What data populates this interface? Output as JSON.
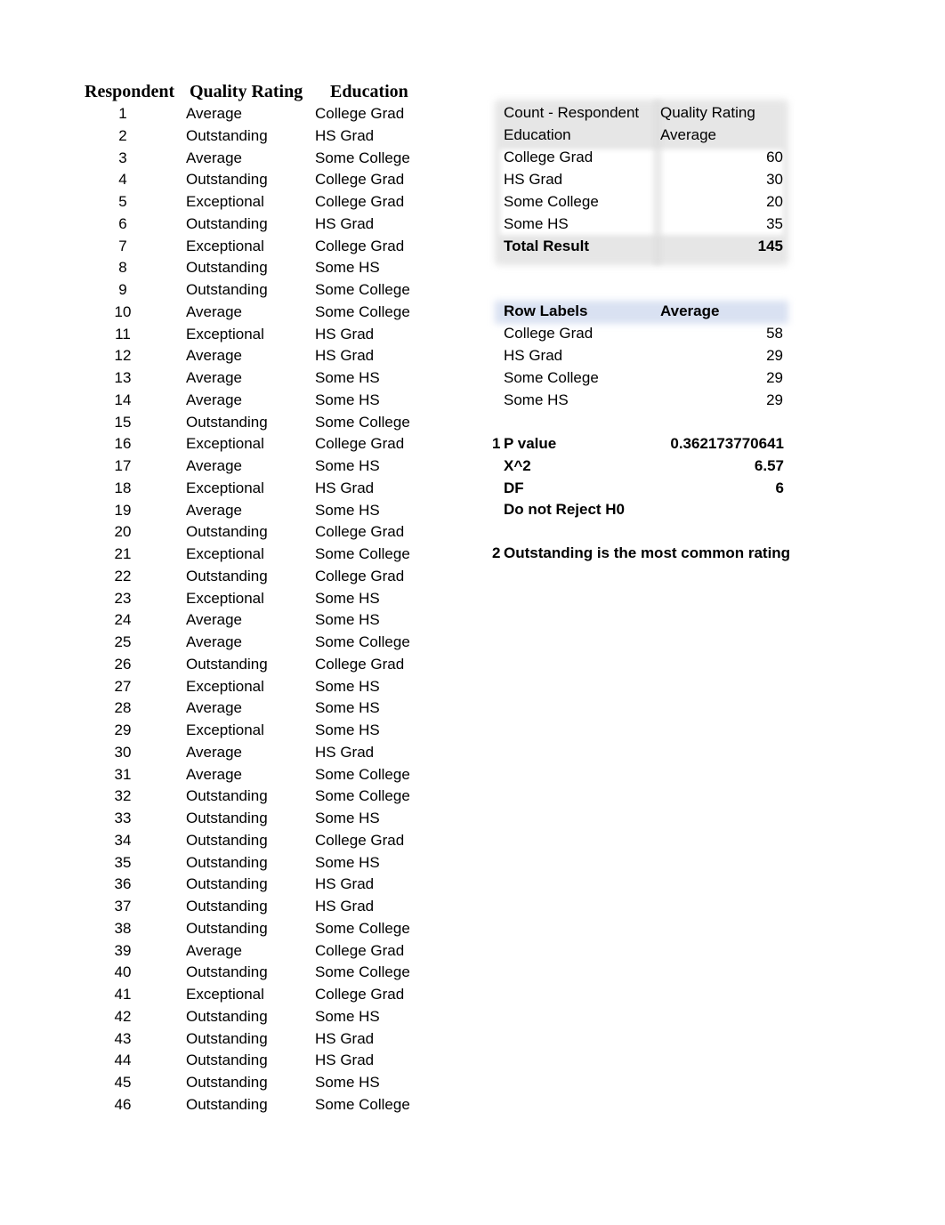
{
  "headers": {
    "respondent": "Respondent",
    "quality_rating": "Quality Rating",
    "education": "Education"
  },
  "rows": [
    {
      "n": "1",
      "q": "Average",
      "e": "College Grad"
    },
    {
      "n": "2",
      "q": "Outstanding",
      "e": "HS Grad"
    },
    {
      "n": "3",
      "q": "Average",
      "e": "Some College"
    },
    {
      "n": "4",
      "q": "Outstanding",
      "e": "College Grad"
    },
    {
      "n": "5",
      "q": "Exceptional",
      "e": "College Grad"
    },
    {
      "n": "6",
      "q": "Outstanding",
      "e": "HS Grad"
    },
    {
      "n": "7",
      "q": "Exceptional",
      "e": "College Grad"
    },
    {
      "n": "8",
      "q": "Outstanding",
      "e": "Some HS"
    },
    {
      "n": "9",
      "q": "Outstanding",
      "e": "Some College"
    },
    {
      "n": "10",
      "q": "Average",
      "e": "Some College"
    },
    {
      "n": "11",
      "q": "Exceptional",
      "e": "HS Grad"
    },
    {
      "n": "12",
      "q": "Average",
      "e": "HS Grad"
    },
    {
      "n": "13",
      "q": "Average",
      "e": "Some HS"
    },
    {
      "n": "14",
      "q": "Average",
      "e": "Some HS"
    },
    {
      "n": "15",
      "q": "Outstanding",
      "e": "Some College"
    },
    {
      "n": "16",
      "q": "Exceptional",
      "e": "College Grad"
    },
    {
      "n": "17",
      "q": "Average",
      "e": "Some HS"
    },
    {
      "n": "18",
      "q": "Exceptional",
      "e": "HS Grad"
    },
    {
      "n": "19",
      "q": "Average",
      "e": "Some HS"
    },
    {
      "n": "20",
      "q": "Outstanding",
      "e": "College Grad"
    },
    {
      "n": "21",
      "q": "Exceptional",
      "e": "Some College"
    },
    {
      "n": "22",
      "q": "Outstanding",
      "e": "College Grad"
    },
    {
      "n": "23",
      "q": "Exceptional",
      "e": "Some HS"
    },
    {
      "n": "24",
      "q": "Average",
      "e": "Some HS"
    },
    {
      "n": "25",
      "q": "Average",
      "e": "Some College"
    },
    {
      "n": "26",
      "q": "Outstanding",
      "e": "College Grad"
    },
    {
      "n": "27",
      "q": "Exceptional",
      "e": "Some HS"
    },
    {
      "n": "28",
      "q": "Average",
      "e": "Some HS"
    },
    {
      "n": "29",
      "q": "Exceptional",
      "e": "Some HS"
    },
    {
      "n": "30",
      "q": "Average",
      "e": "HS Grad"
    },
    {
      "n": "31",
      "q": "Average",
      "e": "Some College"
    },
    {
      "n": "32",
      "q": "Outstanding",
      "e": "Some College"
    },
    {
      "n": "33",
      "q": "Outstanding",
      "e": "Some HS"
    },
    {
      "n": "34",
      "q": "Outstanding",
      "e": "College Grad"
    },
    {
      "n": "35",
      "q": "Outstanding",
      "e": "Some HS"
    },
    {
      "n": "36",
      "q": "Outstanding",
      "e": "HS Grad"
    },
    {
      "n": "37",
      "q": "Outstanding",
      "e": "HS Grad"
    },
    {
      "n": "38",
      "q": "Outstanding",
      "e": "Some College"
    },
    {
      "n": "39",
      "q": "Average",
      "e": "College Grad"
    },
    {
      "n": "40",
      "q": "Outstanding",
      "e": "Some College"
    },
    {
      "n": "41",
      "q": "Exceptional",
      "e": "College Grad"
    },
    {
      "n": "42",
      "q": "Outstanding",
      "e": "Some HS"
    },
    {
      "n": "43",
      "q": "Outstanding",
      "e": "HS Grad"
    },
    {
      "n": "44",
      "q": "Outstanding",
      "e": "HS Grad"
    },
    {
      "n": "45",
      "q": "Outstanding",
      "e": "Some HS"
    },
    {
      "n": "46",
      "q": "Outstanding",
      "e": "Some College"
    }
  ],
  "pivot_count": {
    "corner_label": "Count - Respondent",
    "column_field": "Quality Rating",
    "row_field": "Education",
    "column_value": "Average",
    "rows": [
      {
        "label": "College Grad",
        "value": "60"
      },
      {
        "label": "HS Grad",
        "value": "30"
      },
      {
        "label": "Some College",
        "value": "20"
      },
      {
        "label": "Some HS",
        "value": "35"
      }
    ],
    "total_label": "Total Result",
    "total_value": "145"
  },
  "pivot_average": {
    "row_labels_header": "Row Labels",
    "value_header": "Average",
    "rows": [
      {
        "label": "College Grad",
        "value": "58"
      },
      {
        "label": "HS Grad",
        "value": "29"
      },
      {
        "label": "Some College",
        "value": "29"
      },
      {
        "label": "Some HS",
        "value": "29"
      }
    ]
  },
  "stats": {
    "item1_number": "1",
    "p_value_label": "P value",
    "p_value": "0.362173770641",
    "chi_sq_label": "X^2",
    "chi_sq": "6.57",
    "df_label": "DF",
    "df": "6",
    "conclusion": "Do not Reject H0",
    "item2_number": "2",
    "item2_text": "Outstanding is the most common rating"
  },
  "colors": {
    "pivot_shade": "#e6e6e6",
    "pivot_header_blue": "#d9e1f2"
  }
}
